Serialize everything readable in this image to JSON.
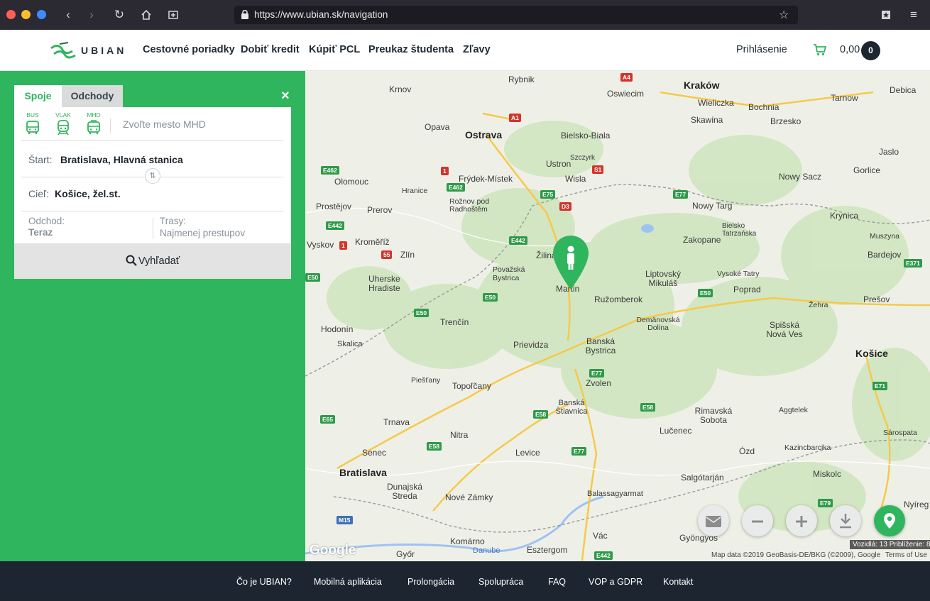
{
  "browser": {
    "url": "https://www.ubian.sk/navigation"
  },
  "header": {
    "logo_text": "UBIAN",
    "nav": [
      "Cestovné poriadky",
      "Dobiť kredit",
      "Kúpiť PCL",
      "Preukaz študenta",
      "Zľavy"
    ],
    "login": "Prihlásenie",
    "cart_amount": "0,00",
    "cart_count": "0"
  },
  "panel": {
    "tabs": [
      "Spoje",
      "Odchody"
    ],
    "close": "×",
    "modes": [
      "BUS",
      "VLAK",
      "MHD"
    ],
    "mhd_placeholder": "Zvoľte mesto MHD",
    "start_label": "Štart:",
    "start_value": "Bratislava, Hlavná stanica",
    "dest_label": "Cieľ:",
    "dest_value": "Košice, žel.st.",
    "departure_label": "Odchod:",
    "departure_value": "Teraz",
    "routes_label": "Trasy:",
    "routes_value": "Najmenej prestupov",
    "search_button": "Vyhľadať",
    "accent_color": "#2fb55d"
  },
  "map": {
    "cities_major": [
      "Kraków",
      "Ostrava",
      "Bratislava",
      "Košice"
    ],
    "cities": [
      "Rybnik",
      "Krnov",
      "Oswiecim",
      "Wieliczka",
      "Bochnia",
      "Tarnow",
      "Debica",
      "Opava",
      "Bielsko-Biala",
      "Skawina",
      "Brzesko",
      "Szczyrk",
      "Ustron",
      "Jaslo",
      "Olomouc",
      "Frýdek-Místek",
      "Wisla",
      "Nowy Sacz",
      "Gorlice",
      "Hranice",
      "Rožnov pod Radhoštěm",
      "Prostějov",
      "Prerov",
      "Nowy Targ",
      "Krynica",
      "Bielsko Tatrzańska",
      "Zakopane",
      "Muszyna",
      "Vyskov",
      "Kroměříž",
      "Zlín",
      "Žilina",
      "Bardejov",
      "Považská Bystrica",
      "Liptovský Mikuláš",
      "Vysoké Tatry",
      "Poprad",
      "Uherske Hradiste",
      "Martin",
      "Ružomberok",
      "Prešov",
      "Trenčín",
      "Žehra",
      "Hodonín",
      "Demänovská Dolina",
      "Spišská Nová Ves",
      "Skalica",
      "Prievidza",
      "Banská Bystrica",
      "Piešťany",
      "Topoľčany",
      "Zvolen",
      "Banská Štiavnica",
      "Rimavská Sobota",
      "Aggtelek",
      "Trnava",
      "Nitra",
      "Lučenec",
      "Sárospata",
      "Senec",
      "Levice",
      "Ózd",
      "Kazincbarcika",
      "Salgótarján",
      "Miskolc",
      "Dunajská Streda",
      "Nové Zámky",
      "Balassagyarmat",
      "Nyíreg",
      "Komárno",
      "Vác",
      "Gyöngyös",
      "Győr",
      "Esztergom",
      "Danube"
    ],
    "roads": [
      "A4",
      "A1",
      "E462",
      "E442",
      "S1",
      "E75",
      "D3",
      "E77",
      "1",
      "55",
      "E50",
      "E371",
      "E65",
      "E58",
      "E71",
      "E79",
      "M15"
    ],
    "vehicles_info": "Vozidlá: 13 Priblíženie: 8",
    "attribution": "Map data ©2019 GeoBasis-DE/BKG (©2009), Google",
    "terms": "Terms of Use",
    "google": "Google"
  },
  "footer": {
    "links": [
      "Čo je UBIAN?",
      "Mobilná aplikácia",
      "Prolongácia",
      "Spolupráca",
      "FAQ",
      "VOP a GDPR",
      "Kontakt"
    ]
  }
}
